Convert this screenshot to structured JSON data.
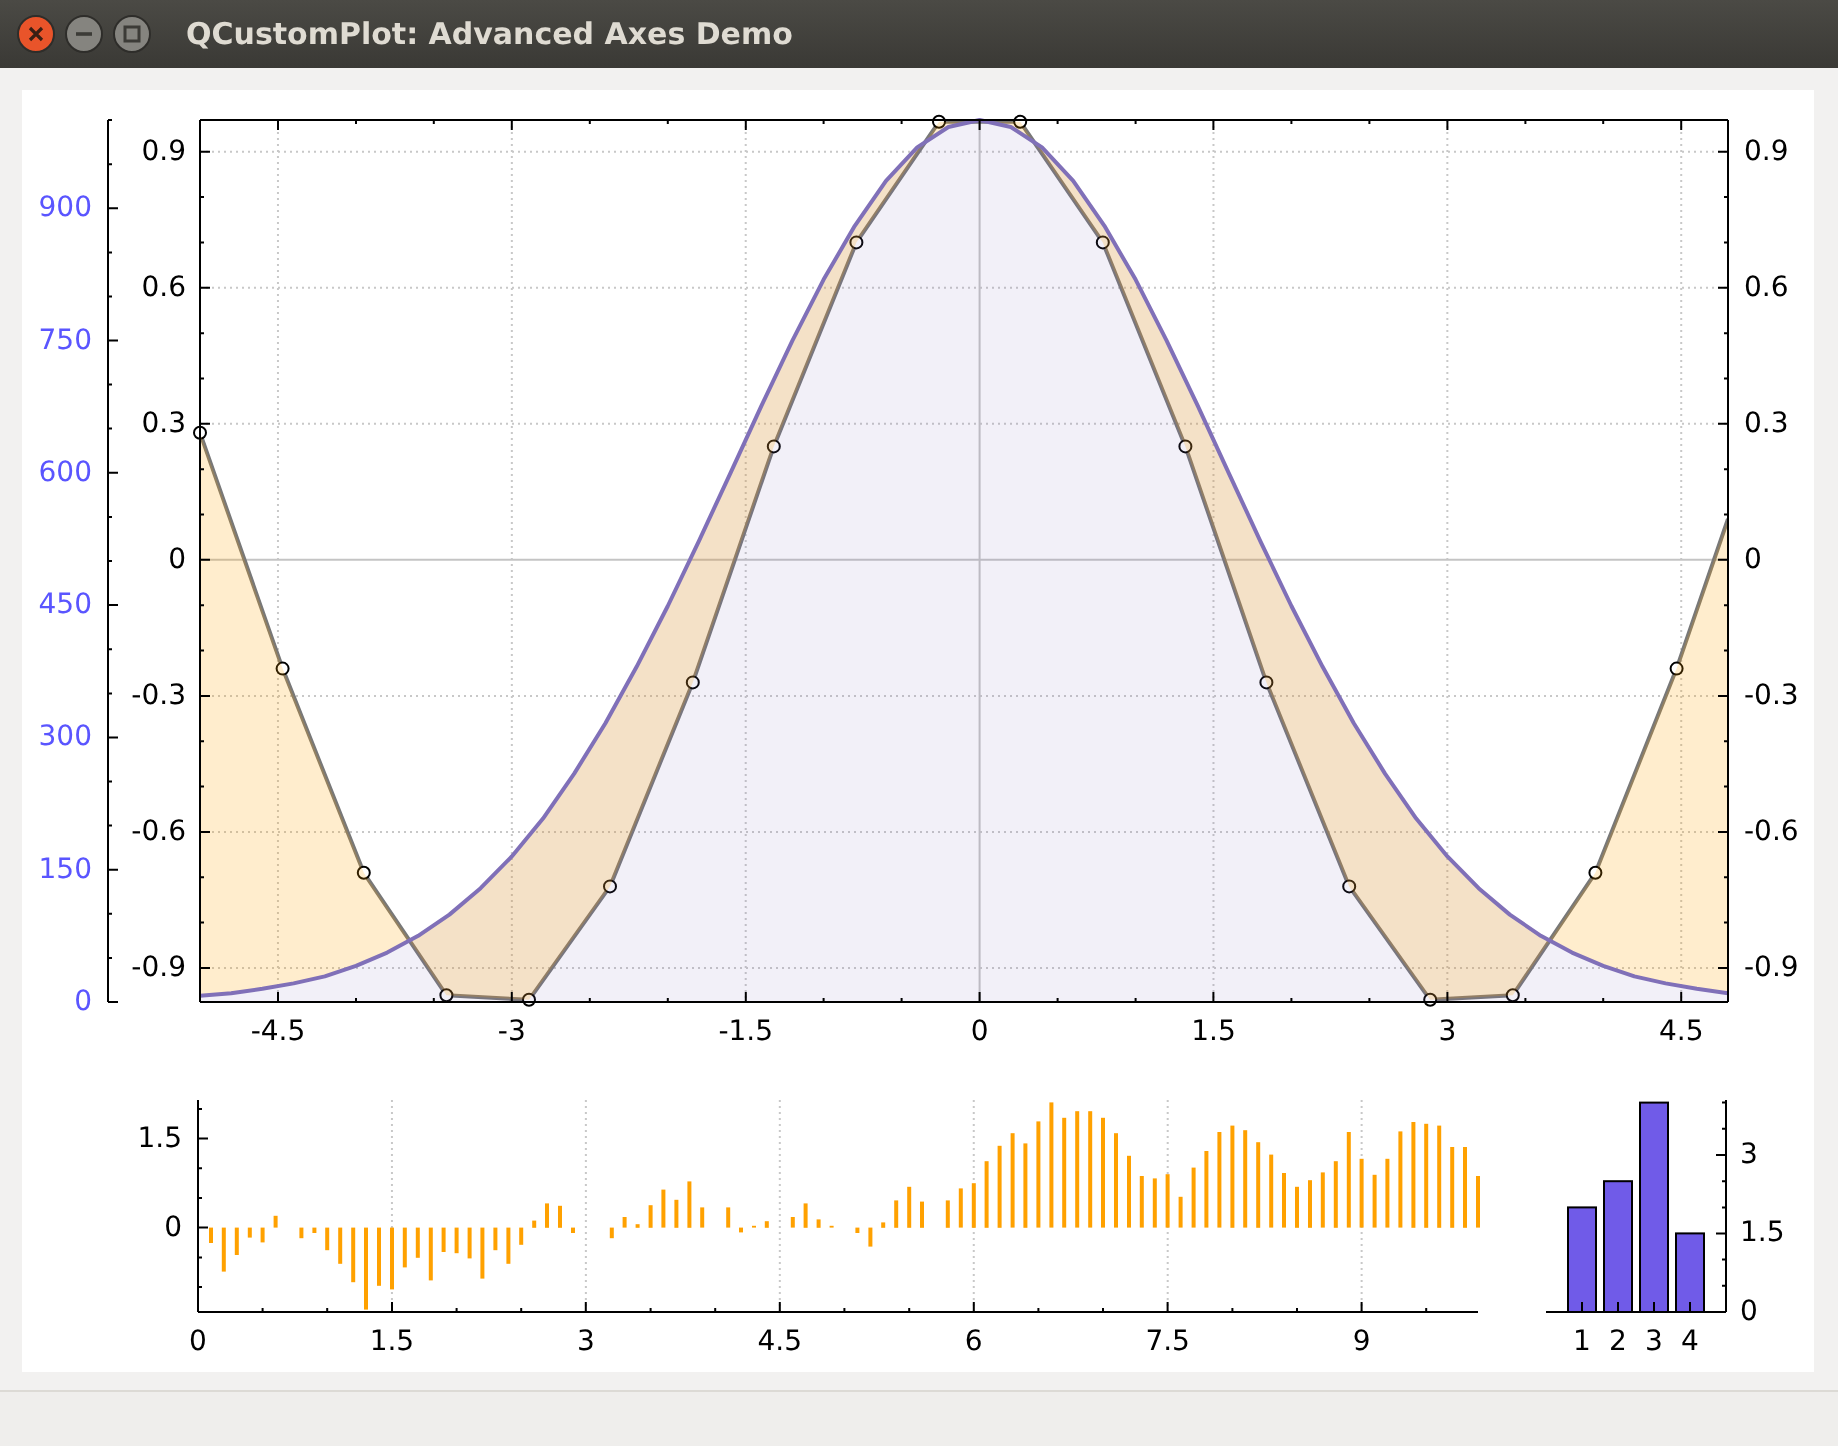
{
  "window": {
    "title": "QCustomPlot: Advanced Axes Demo"
  },
  "main_plot": {
    "chart_data": {
      "type": "line",
      "grid": true,
      "xlim": [
        -5,
        4.8
      ],
      "ylim": [
        -0.975,
        0.97
      ],
      "y2lim": [
        0,
        1000
      ],
      "xticks": [
        -4.5,
        -3,
        -1.5,
        0,
        1.5,
        3,
        4.5
      ],
      "yticks": [
        -0.9,
        -0.6,
        -0.3,
        0,
        0.3,
        0.6,
        0.9
      ],
      "y2ticks": [
        0,
        150,
        300,
        450,
        600,
        750,
        900
      ],
      "series": [
        {
          "type": "line",
          "color": "#787878",
          "axis": "y",
          "marker": "circle",
          "x": [
            -5,
            -4.47,
            -3.95,
            -3.42,
            -2.89,
            -2.37,
            -1.84,
            -1.32,
            -0.79,
            -0.26,
            0.26,
            0.79,
            1.32,
            1.84,
            2.37,
            2.89,
            3.42,
            3.95,
            4.47,
            4.8
          ],
          "values": [
            0.28,
            -0.24,
            -0.69,
            -0.96,
            -0.97,
            -0.72,
            -0.27,
            0.25,
            0.7,
            0.966,
            0.966,
            0.7,
            0.25,
            -0.27,
            -0.72,
            -0.97,
            -0.96,
            -0.69,
            -0.24,
            0.09
          ]
        },
        {
          "type": "area",
          "color": "#8070b8",
          "axis": "y2",
          "x": [
            -5,
            -4.8,
            -4.6,
            -4.4,
            -4.2,
            -4,
            -3.8,
            -3.6,
            -3.4,
            -3.2,
            -3,
            -2.8,
            -2.6,
            -2.4,
            -2.2,
            -2,
            -1.8,
            -1.6,
            -1.4,
            -1.2,
            -1,
            -0.8,
            -0.6,
            -0.4,
            -0.2,
            0,
            0.2,
            0.4,
            0.6,
            0.8,
            1,
            1.2,
            1.4,
            1.6,
            1.8,
            2,
            2.2,
            2.4,
            2.6,
            2.8,
            3,
            3.2,
            3.4,
            3.6,
            3.8,
            4,
            4.2,
            4.4,
            4.6,
            4.8
          ],
          "values": [
            7,
            10,
            15,
            21,
            29,
            41,
            56,
            75,
            99,
            129,
            165,
            208,
            259,
            316,
            380,
            449,
            523,
            599,
            676,
            750,
            819,
            880,
            931,
            969,
            992,
            1000,
            992,
            969,
            931,
            880,
            819,
            750,
            676,
            599,
            523,
            449,
            380,
            316,
            259,
            208,
            165,
            129,
            99,
            75,
            56,
            41,
            29,
            21,
            15,
            10
          ]
        }
      ]
    },
    "right_axis_labels": [
      "0.9",
      "0.6",
      "0.3",
      "0",
      "-0.3",
      "-0.6",
      "-0.9"
    ]
  },
  "sub_plot": {
    "chart_data": {
      "type": "bar",
      "grid": true,
      "xlim": [
        0,
        9.9
      ],
      "ylim": [
        -1.42,
        2.15
      ],
      "xticks": [
        0,
        1.5,
        3,
        4.5,
        6,
        7.5,
        9
      ],
      "yticks": [
        0,
        1.5
      ],
      "x": [
        0.1,
        0.2,
        0.3,
        0.4,
        0.5,
        0.6,
        0.7,
        0.8,
        0.9,
        1,
        1.1,
        1.2,
        1.3,
        1.4,
        1.5,
        1.6,
        1.7,
        1.8,
        1.9,
        2,
        2.1,
        2.2,
        2.3,
        2.4,
        2.5,
        2.6,
        2.7,
        2.8,
        2.9,
        3,
        3.1,
        3.2,
        3.3,
        3.4,
        3.5,
        3.6,
        3.7,
        3.8,
        3.9,
        4,
        4.1,
        4.2,
        4.3,
        4.4,
        4.5,
        4.6,
        4.7,
        4.8,
        4.9,
        5,
        5.1,
        5.2,
        5.3,
        5.4,
        5.5,
        5.6,
        5.7,
        5.8,
        5.9,
        6,
        6.1,
        6.2,
        6.3,
        6.4,
        6.5,
        6.6,
        6.7,
        6.8,
        6.9,
        7,
        7.1,
        7.2,
        7.3,
        7.4,
        7.5,
        7.6,
        7.7,
        7.8,
        7.9,
        8,
        8.1,
        8.2,
        8.3,
        8.4,
        8.5,
        8.6,
        8.7,
        8.8,
        8.9,
        9,
        9.1,
        9.2,
        9.3,
        9.4,
        9.5,
        9.6,
        9.7,
        9.8,
        9.9
      ],
      "series": [
        {
          "color": "#ffa100",
          "values": [
            -0.26,
            -0.74,
            -0.46,
            -0.17,
            -0.25,
            0.2,
            0,
            -0.18,
            -0.09,
            -0.38,
            -0.61,
            -0.92,
            -1.38,
            -0.98,
            -1.04,
            -0.67,
            -0.51,
            -0.89,
            -0.41,
            -0.43,
            -0.52,
            -0.86,
            -0.38,
            -0.61,
            -0.29,
            0.12,
            0.41,
            0.37,
            -0.09,
            0,
            0,
            -0.18,
            0.18,
            0.06,
            0.38,
            0.64,
            0.47,
            0.78,
            0.34,
            0,
            0.34,
            -0.08,
            0.03,
            0.11,
            0,
            0.18,
            0.41,
            0.14,
            0.03,
            0,
            -0.09,
            -0.32,
            0.09,
            0.46,
            0.69,
            0.44,
            0,
            0.46,
            0.66,
            0.75,
            1.12,
            1.38,
            1.59,
            1.42,
            1.79,
            2.11,
            1.85,
            1.96,
            1.96,
            1.85,
            1.59,
            1.21,
            0.87,
            0.83,
            0.9,
            0.52,
            1.01,
            1.29,
            1.61,
            1.72,
            1.64,
            1.44,
            1.23,
            0.92,
            0.69,
            0.8,
            0.93,
            1.12,
            1.61,
            1.16,
            0.89,
            1.16,
            1.62,
            1.78,
            1.75,
            1.72,
            1.36,
            1.36,
            0.87
          ]
        }
      ]
    }
  },
  "bar_plot": {
    "chart_data": {
      "type": "bar",
      "categories": [
        "1",
        "2",
        "3",
        "4"
      ],
      "ylim": [
        0,
        4.05
      ],
      "yticks": [
        0,
        1.5,
        3
      ],
      "series": [
        {
          "color": "#705be8",
          "values": [
            2,
            2.5,
            4,
            1.5
          ]
        }
      ]
    }
  }
}
